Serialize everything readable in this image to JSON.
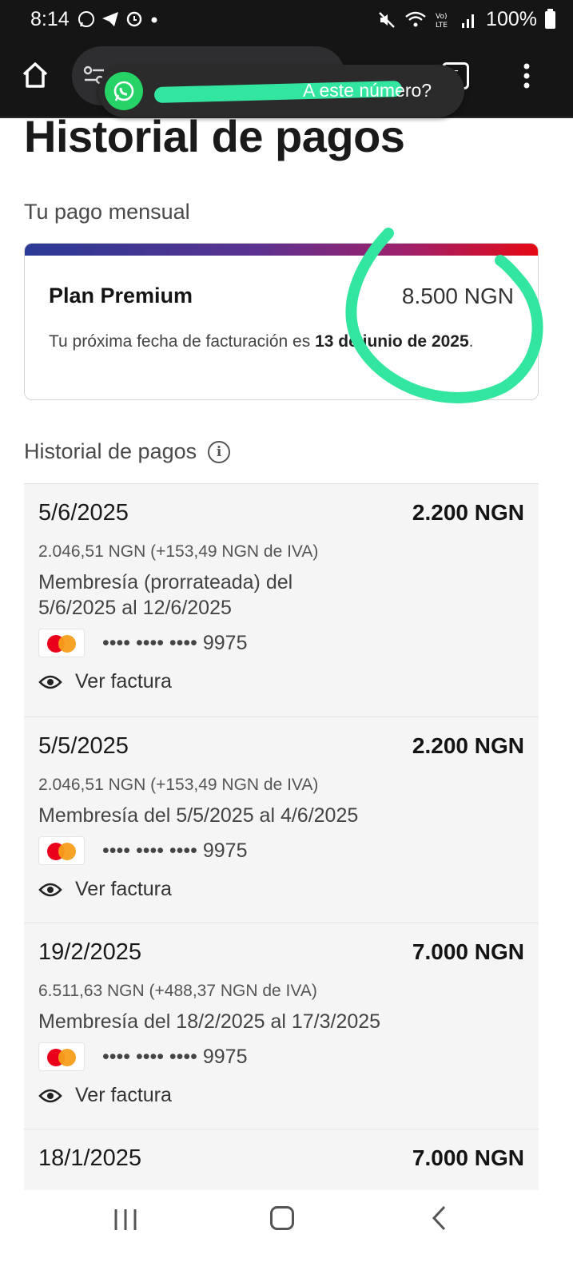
{
  "status_bar": {
    "time": "8:14",
    "battery": "100%",
    "icons": [
      "whatsapp-icon",
      "telegram-icon",
      "sync-icon",
      "dot-icon",
      "mute-icon",
      "wifi-icon",
      "volte-icon",
      "signal-icon",
      "battery-icon"
    ]
  },
  "browser": {
    "tabs_count": "5"
  },
  "whatsapp_popup": {
    "text": "A este número?"
  },
  "page": {
    "title": "Historial de pagos",
    "monthly_label": "Tu pago mensual",
    "plan": {
      "name": "Plan Premium",
      "price": "8.500 NGN",
      "next_billing_prefix": "Tu próxima fecha de facturación es",
      "next_billing_date": "13 de junio de 2025",
      "next_billing_suffix": "."
    },
    "history_label": "Historial de pagos",
    "payments": [
      {
        "date": "5/6/2025",
        "amount": "2.200 NGN",
        "tax": "2.046,51 NGN (+153,49 NGN de IVA)",
        "desc": "Membresía (prorrateada) del 5/6/2025 al 12/6/2025",
        "card": "•••• •••• •••• 9975",
        "invoice": "Ver factura"
      },
      {
        "date": "5/5/2025",
        "amount": "2.200 NGN",
        "tax": "2.046,51 NGN (+153,49 NGN de IVA)",
        "desc": "Membresía del 5/5/2025 al 4/6/2025",
        "card": "•••• •••• •••• 9975",
        "invoice": "Ver factura"
      },
      {
        "date": "19/2/2025",
        "amount": "7.000 NGN",
        "tax": "6.511,63 NGN (+488,37 NGN de IVA)",
        "desc": "Membresía del 18/2/2025 al 17/3/2025",
        "card": "•••• •••• •••• 9975",
        "invoice": "Ver factura"
      },
      {
        "date": "18/1/2025",
        "amount": "7.000 NGN"
      }
    ]
  },
  "colors": {
    "annotation": "#33e6a0",
    "mastercard_red": "#eb001b",
    "mastercard_orange": "#f79e1b",
    "band_start": "#2a3a96",
    "band_end": "#e50914"
  }
}
